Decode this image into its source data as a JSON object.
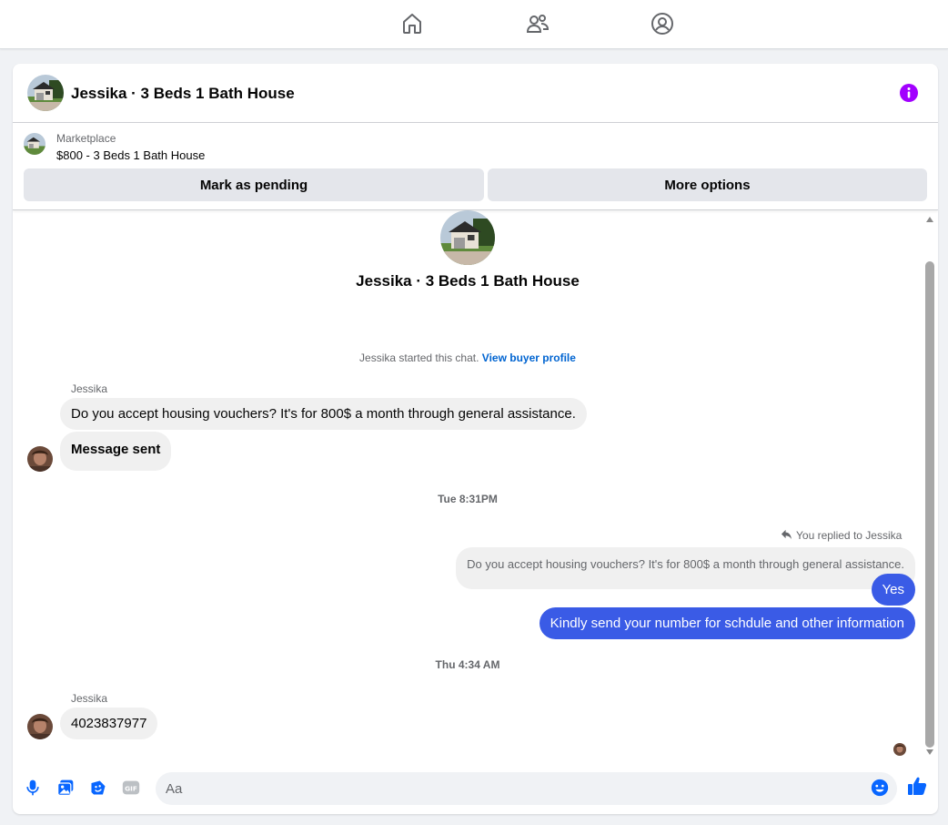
{
  "colors": {
    "accent": "#0866ff",
    "outgoing_bubble": "#3a5be6",
    "info_purple": "#a200ff",
    "link": "#0064d1"
  },
  "topnav": {
    "icons": [
      "home-icon",
      "friends-icon",
      "profile-circle-icon"
    ]
  },
  "header": {
    "title": "Jessika · 3 Beds 1 Bath House",
    "info_icon": "info-icon"
  },
  "listing": {
    "label": "Marketplace",
    "subtitle": "$800 - 3 Beds 1 Bath House",
    "buttons": {
      "pending": "Mark as pending",
      "more": "More options"
    }
  },
  "thread": {
    "title": "Jessika · 3 Beds 1 Bath House",
    "system_text": "Jessika started this chat.",
    "system_link": "View buyer profile",
    "groups": [
      {
        "sender": "Jessika",
        "messages": [
          "Do you accept housing vouchers? It's for 800$ a month through general assistance.",
          "Message sent"
        ]
      }
    ],
    "time_1": "Tue 8:31PM",
    "reply_note": "You replied to Jessika",
    "quoted": "Do you accept housing vouchers? It's for 800$ a month through general assistance.",
    "outgoing": [
      "Yes",
      "Kindly send your number for schdule and other information"
    ],
    "time_2": "Thu 4:34 AM",
    "group_2": {
      "sender": "Jessika",
      "message": "4023837977"
    }
  },
  "composer": {
    "placeholder": "Aa",
    "icons": [
      "microphone-icon",
      "image-icon",
      "sticker-icon",
      "gif-icon",
      "emoji-icon",
      "like-icon"
    ],
    "gif_label": "GIF"
  }
}
